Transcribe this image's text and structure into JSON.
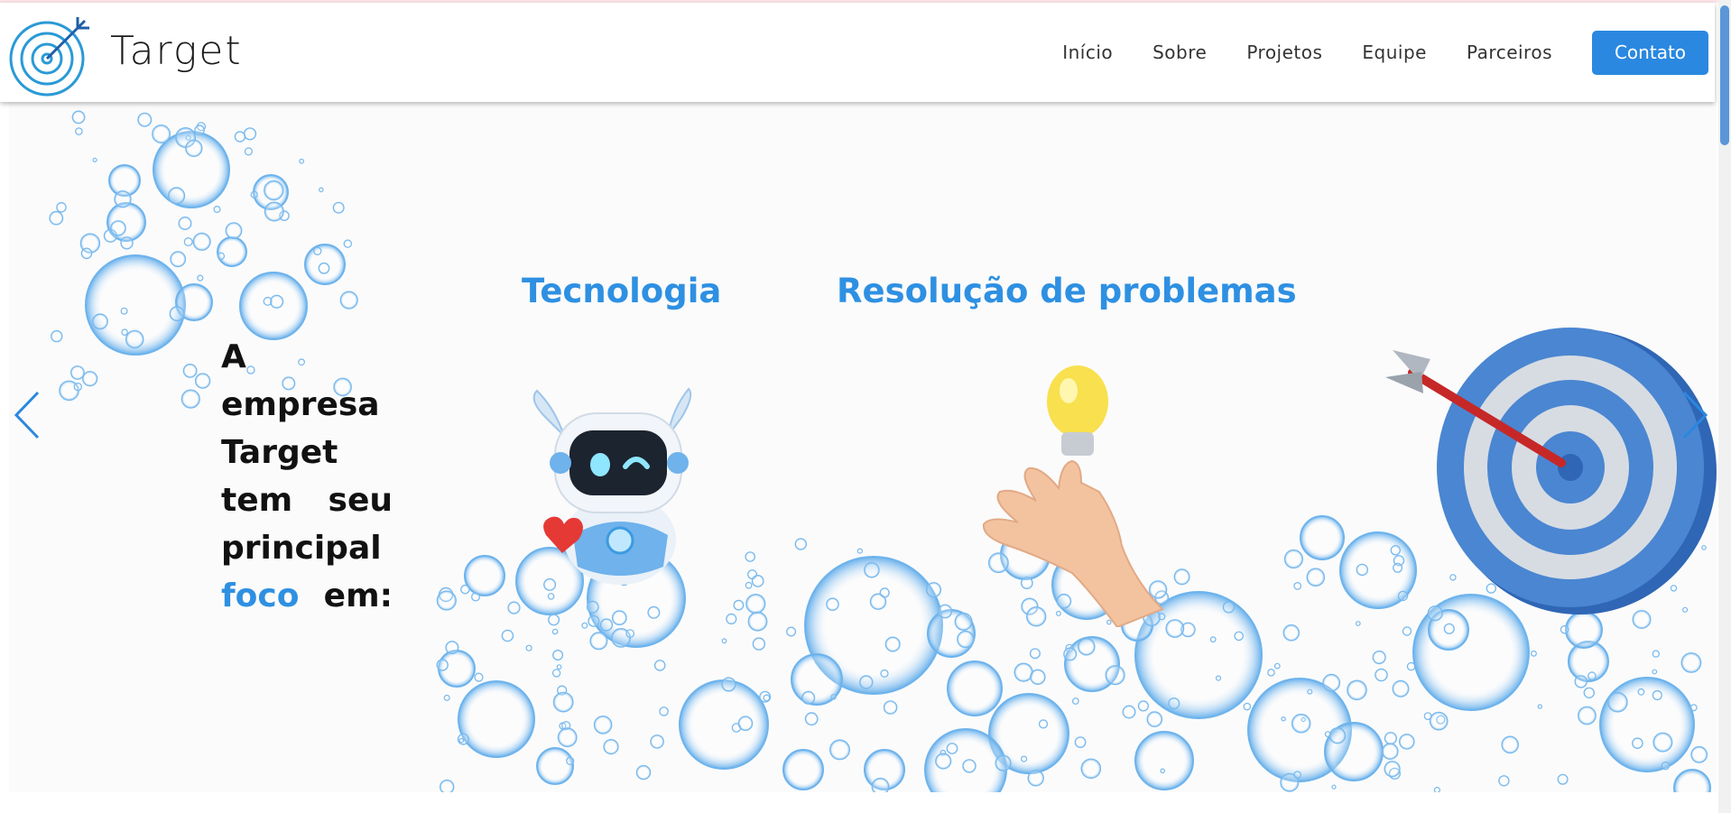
{
  "header": {
    "brand": "Target",
    "logo_icon": "target-arrow-icon",
    "nav": [
      {
        "label": "Início"
      },
      {
        "label": "Sobre"
      },
      {
        "label": "Projetos"
      },
      {
        "label": "Equipe"
      },
      {
        "label": "Parceiros"
      }
    ],
    "cta_label": "Contato"
  },
  "hero": {
    "lead_words": [
      "A",
      "empresa",
      "Target",
      "tem",
      "seu",
      "principal",
      "foco",
      "em:"
    ],
    "headings": {
      "tech": "Tecnologia",
      "problems": "Resolução de problemas"
    },
    "illustrations": [
      "robot-heart-icon",
      "lightbulb-hand-icon",
      "dartboard-arrow-icon"
    ],
    "prev_icon": "chevron-left-icon",
    "next_icon": "chevron-right-icon"
  },
  "colors": {
    "accent": "#2e90e2",
    "button": "#2a88e0",
    "bubble": "#5aa9ea"
  }
}
